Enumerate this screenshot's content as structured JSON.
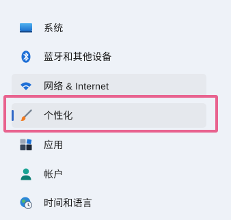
{
  "nav": {
    "items": [
      {
        "label": "系统",
        "icon": "monitor-icon"
      },
      {
        "label": "蓝牙和其他设备",
        "icon": "bluetooth-icon"
      },
      {
        "label": "网络 & Internet",
        "icon": "wifi-icon"
      },
      {
        "label": "个性化",
        "icon": "brush-icon"
      },
      {
        "label": "应用",
        "icon": "apps-icon"
      },
      {
        "label": "帐户",
        "icon": "person-icon"
      },
      {
        "label": "时间和语言",
        "icon": "globe-clock-icon"
      }
    ],
    "selected_index": 3
  },
  "colors": {
    "background": "#eef2f8",
    "accent": "#2f67c7",
    "highlight_border": "#e8638f"
  }
}
